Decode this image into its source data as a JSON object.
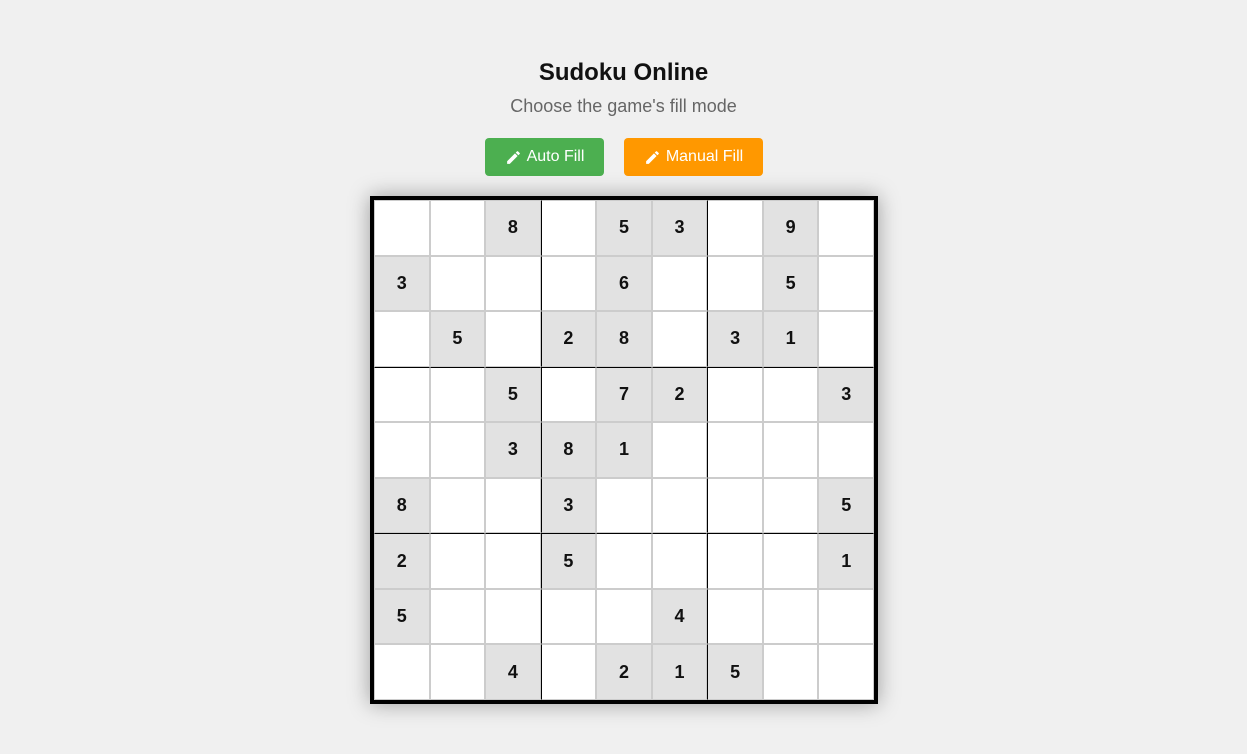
{
  "header": {
    "title": "Sudoku Online",
    "subtitle": "Choose the game's fill mode"
  },
  "buttons": {
    "auto_fill": {
      "label": "Auto Fill",
      "icon": "pencil-icon",
      "color": "#4caf50"
    },
    "manual_fill": {
      "label": "Manual Fill",
      "icon": "pencil-icon",
      "color": "#ff9800"
    }
  },
  "colors": {
    "background": "#f0f0f0",
    "given_cell": "#e2e2e2",
    "empty_cell": "#ffffff"
  },
  "board": {
    "rows": [
      [
        "",
        "",
        "8",
        "",
        "5",
        "3",
        "",
        "9",
        ""
      ],
      [
        "3",
        "",
        "",
        "",
        "6",
        "",
        "",
        "5",
        ""
      ],
      [
        "",
        "5",
        "",
        "2",
        "8",
        "",
        "3",
        "1",
        ""
      ],
      [
        "",
        "",
        "5",
        "",
        "7",
        "2",
        "",
        "",
        "3"
      ],
      [
        "",
        "",
        "3",
        "8",
        "1",
        "",
        "",
        "",
        ""
      ],
      [
        "8",
        "",
        "",
        "3",
        "",
        "",
        "",
        "",
        "5"
      ],
      [
        "2",
        "",
        "",
        "5",
        "",
        "",
        "",
        "",
        "1"
      ],
      [
        "5",
        "",
        "",
        "",
        "",
        "4",
        "",
        "",
        ""
      ],
      [
        "",
        "",
        "4",
        "",
        "2",
        "1",
        "5",
        "",
        ""
      ]
    ]
  }
}
